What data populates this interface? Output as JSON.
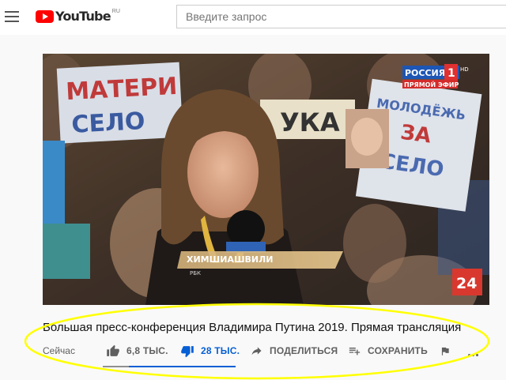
{
  "header": {
    "logo_text": "YouTube",
    "logo_region": "RU",
    "search_placeholder": "Введите запрос"
  },
  "video": {
    "channel_badge": "РОССИЯ",
    "channel_badge_number": "1",
    "channel_badge_hd": "HD",
    "live_label": "ПРЯМОЙ ЭФИР",
    "lower_third_name": "ХИМШИАШВИЛИ",
    "lower_third_sub": "РБК",
    "corner_logo": "24",
    "signs": {
      "left_line1": "МАТЕРИ",
      "left_line2": "СЕЛО",
      "middle": "УКА",
      "right_line1": "МОЛОДЁЖЬ",
      "right_line2": "ЗА",
      "right_line3": "СЕЛО"
    }
  },
  "title": "Большая пресс-конференция Владимира Путина 2019. Прямая трансляция",
  "meta": {
    "date": "Сейчас",
    "likes": "6,8 ТЫС.",
    "dislikes": "28 ТЫС.",
    "like_ratio": 0.195,
    "share_label": "ПОДЕЛИТЬСЯ",
    "save_label": "СОХРАНИТЬ"
  },
  "icons": [
    "menu-icon",
    "youtube-play-icon",
    "thumbs-up-icon",
    "thumbs-down-icon",
    "share-icon",
    "add-to-playlist-icon",
    "flag-icon",
    "more-icon"
  ],
  "colors": {
    "brand_red": "#ff0000",
    "active_blue": "#065fd4",
    "highlight_yellow": "#ffff00",
    "secondary_text": "#606060"
  }
}
